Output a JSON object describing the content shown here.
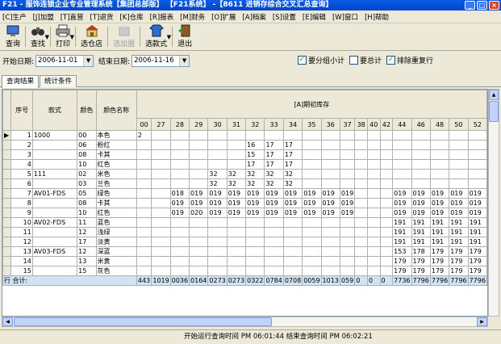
{
  "window": {
    "title": "F21 - 服饰连锁企业专业管理系统【集团总部版】 【F21系统】 -【8611 进销存综合交叉汇总查询】",
    "min": "_",
    "max": "□",
    "close": "×"
  },
  "menu": [
    "[C]生产",
    "[J]加盟",
    "[T]直营",
    "[T]退货",
    "[K]仓库",
    "[R]报表",
    "[M]财务",
    "[O]扩展",
    "[A]档案",
    "[S]设置",
    "[E]编辑",
    "[W]窗口",
    "[H]帮助"
  ],
  "toolbar": {
    "query": "查询",
    "find": "查找",
    "print": "打印",
    "select_store": "选仓店",
    "add_franchise": "选加盟",
    "select_style": "选款式",
    "exit": "退出",
    "caret": "▼"
  },
  "filter": {
    "start_label": "开始日期:",
    "start_value": "2006-11-01",
    "end_label": "结束日期:",
    "end_value": "2006-11-16",
    "group_subtotal": "要分组小计",
    "grand_total": "要总计",
    "exclude_dup": "排除重复行",
    "check_mark": "✓",
    "arrow": "▼"
  },
  "tabs": [
    "查询结果",
    "统计条件"
  ],
  "grid": {
    "headers": {
      "seq": "序号",
      "style": "款式",
      "color": "颜色",
      "color_name": "颜色名称",
      "group": "[A]期初库存"
    },
    "size_cols": [
      "00",
      "27",
      "28",
      "29",
      "30",
      "31",
      "32",
      "33",
      "34",
      "35",
      "36",
      "37",
      "38",
      "40",
      "42",
      "44",
      "46",
      "48",
      "50",
      "52"
    ],
    "rows": [
      {
        "seq": "1",
        "style": "1000",
        "color": "00",
        "name": "本色",
        "cells": [
          "2",
          "",
          "",
          "",
          "",
          "",
          "",
          "",
          "",
          "",
          "",
          "",
          "",
          "",
          "",
          "",
          "",
          "",
          "",
          ""
        ]
      },
      {
        "seq": "2",
        "style": "",
        "color": "06",
        "name": "粉红",
        "cells": [
          "",
          "",
          "",
          "",
          "",
          "",
          "16",
          "17",
          "17",
          "",
          "",
          "",
          "",
          "",
          "",
          "",
          "",
          "",
          "",
          ""
        ]
      },
      {
        "seq": "3",
        "style": "",
        "color": "08",
        "name": "卡其",
        "cells": [
          "",
          "",
          "",
          "",
          "",
          "",
          "15",
          "17",
          "17",
          "",
          "",
          "",
          "",
          "",
          "",
          "",
          "",
          "",
          "",
          ""
        ]
      },
      {
        "seq": "4",
        "style": "",
        "color": "10",
        "name": "红色",
        "cells": [
          "",
          "",
          "",
          "",
          "",
          "",
          "17",
          "17",
          "17",
          "",
          "",
          "",
          "",
          "",
          "",
          "",
          "",
          "",
          "",
          ""
        ]
      },
      {
        "seq": "5",
        "style": "111",
        "color": "02",
        "name": "米色",
        "cells": [
          "",
          "",
          "",
          "",
          "32",
          "32",
          "32",
          "32",
          "32",
          "",
          "",
          "",
          "",
          "",
          "",
          "",
          "",
          "",
          "",
          ""
        ]
      },
      {
        "seq": "6",
        "style": "",
        "color": "03",
        "name": "兰色",
        "cells": [
          "",
          "",
          "",
          "",
          "32",
          "32",
          "32",
          "32",
          "32",
          "",
          "",
          "",
          "",
          "",
          "",
          "",
          "",
          "",
          "",
          ""
        ]
      },
      {
        "seq": "7",
        "style": "AV01-FDS",
        "color": "05",
        "name": "绿色",
        "cells": [
          "",
          "",
          "018",
          "019",
          "019",
          "019",
          "019",
          "019",
          "019",
          "019",
          "019",
          "019",
          "",
          "",
          "",
          "019",
          "019",
          "019",
          "019",
          "019"
        ]
      },
      {
        "seq": "8",
        "style": "",
        "color": "08",
        "name": "卡其",
        "cells": [
          "",
          "",
          "019",
          "019",
          "019",
          "019",
          "019",
          "019",
          "019",
          "019",
          "019",
          "019",
          "",
          "",
          "",
          "019",
          "019",
          "019",
          "019",
          "019"
        ]
      },
      {
        "seq": "9",
        "style": "",
        "color": "10",
        "name": "红色",
        "cells": [
          "",
          "",
          "019",
          "020",
          "019",
          "019",
          "019",
          "019",
          "019",
          "019",
          "019",
          "019",
          "",
          "",
          "",
          "019",
          "019",
          "019",
          "019",
          "019"
        ]
      },
      {
        "seq": "10",
        "style": "AV02-FDS",
        "color": "11",
        "name": "蓝色",
        "cells": [
          "",
          "",
          "",
          "",
          "",
          "",
          "",
          "",
          "",
          "",
          "",
          "",
          "",
          "",
          "",
          "191",
          "191",
          "191",
          "191",
          "191"
        ]
      },
      {
        "seq": "11",
        "style": "",
        "color": "12",
        "name": "浅绿",
        "cells": [
          "",
          "",
          "",
          "",
          "",
          "",
          "",
          "",
          "",
          "",
          "",
          "",
          "",
          "",
          "",
          "191",
          "191",
          "191",
          "191",
          "191"
        ]
      },
      {
        "seq": "12",
        "style": "",
        "color": "17",
        "name": "淡黄",
        "cells": [
          "",
          "",
          "",
          "",
          "",
          "",
          "",
          "",
          "",
          "",
          "",
          "",
          "",
          "",
          "",
          "191",
          "191",
          "191",
          "191",
          "191"
        ]
      },
      {
        "seq": "13",
        "style": "AV03-FDS",
        "color": "12",
        "name": "深蓝",
        "cells": [
          "",
          "",
          "",
          "",
          "",
          "",
          "",
          "",
          "",
          "",
          "",
          "",
          "",
          "",
          "",
          "153",
          "178",
          "179",
          "179",
          "179"
        ]
      },
      {
        "seq": "14",
        "style": "",
        "color": "13",
        "name": "米黄",
        "cells": [
          "",
          "",
          "",
          "",
          "",
          "",
          "",
          "",
          "",
          "",
          "",
          "",
          "",
          "",
          "",
          "179",
          "179",
          "179",
          "179",
          "179"
        ]
      },
      {
        "seq": "15",
        "style": "",
        "color": "15",
        "name": "灰色",
        "cells": [
          "",
          "",
          "",
          "",
          "",
          "",
          "",
          "",
          "",
          "",
          "",
          "",
          "",
          "",
          "",
          "179",
          "179",
          "179",
          "179",
          "179"
        ]
      }
    ],
    "summary": {
      "label": "行 合计:",
      "cells": [
        "443",
        "1019",
        "0036",
        "0164",
        "0273",
        "0273",
        "0322",
        "0784",
        "0708",
        "0059",
        "1013",
        "059",
        "0",
        "0",
        "0",
        "7736",
        "7796",
        "7796",
        "7796",
        "7796"
      ]
    }
  },
  "status": "开始运行查询时间 PM 06:01:44 结束查询时间 PM 06:02:21"
}
